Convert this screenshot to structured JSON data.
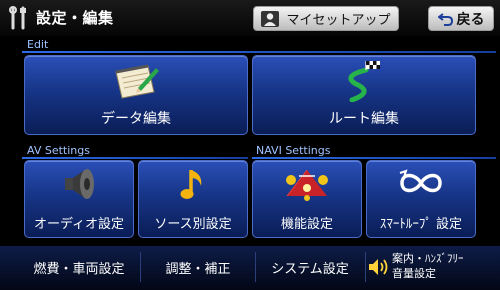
{
  "header": {
    "title": "設定・編集",
    "myset_label": "マイセットアップ",
    "back_label": "戻る"
  },
  "sections": {
    "edit": "Edit",
    "av": "AV Settings",
    "navi": "NAVI Settings"
  },
  "tiles": {
    "data_edit": "データ編集",
    "route_edit": "ルート編集",
    "audio": "オーディオ設定",
    "source": "ソース別設定",
    "function": "機能設定",
    "smartloop": "ｽﾏｰﾄﾙｰﾌﾟ 設定"
  },
  "bottom": {
    "fuel": "燃費・車両設定",
    "adjust": "調整・補正",
    "system": "システム設定",
    "guide_line1": "案内・ﾊﾝｽﾞﾌﾘｰ",
    "guide_line2": "音量設定"
  },
  "icons": {
    "title": "tools-icon",
    "myset": "person-icon",
    "back": "back-arrow-icon",
    "data_edit": "notepad-pencil-icon",
    "route_edit": "route-flag-icon",
    "audio": "speaker-icon",
    "source": "music-note-icon",
    "function": "radar-target-icon",
    "smartloop": "infinity-loop-icon",
    "guide": "speaker-volume-icon"
  },
  "colors": {
    "tile": "#1e3f9e",
    "section_text": "#9fc3ff",
    "section_line": "#2e6be8"
  }
}
